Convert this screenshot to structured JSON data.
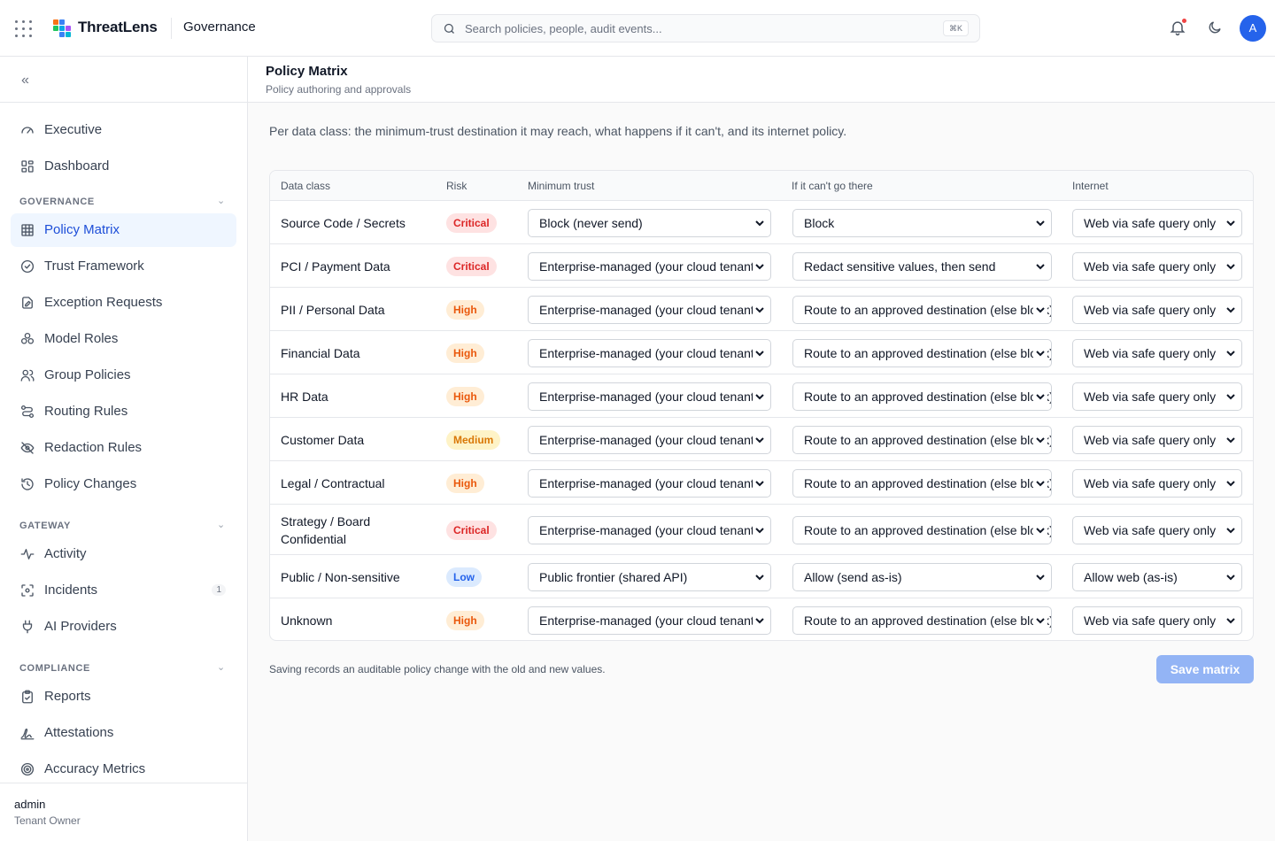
{
  "app": {
    "brand": "ThreatLens",
    "section": "Governance"
  },
  "search": {
    "placeholder": "Search policies, people, audit events...",
    "shortcut": "⌘K"
  },
  "avatar": {
    "initial": "A"
  },
  "sidebar": {
    "top_items": [
      {
        "label": "Executive",
        "icon": "gauge-icon"
      },
      {
        "label": "Dashboard",
        "icon": "dashboard-icon"
      }
    ],
    "groups": [
      {
        "title": "GOVERNANCE",
        "items": [
          {
            "label": "Policy Matrix",
            "icon": "grid-icon",
            "active": true
          },
          {
            "label": "Trust Framework",
            "icon": "shield-check-icon"
          },
          {
            "label": "Exception Requests",
            "icon": "file-edit-icon"
          },
          {
            "label": "Model Roles",
            "icon": "boxes-icon"
          },
          {
            "label": "Group Policies",
            "icon": "users-icon"
          },
          {
            "label": "Routing Rules",
            "icon": "route-icon"
          },
          {
            "label": "Redaction Rules",
            "icon": "eye-off-icon"
          },
          {
            "label": "Policy Changes",
            "icon": "history-icon"
          }
        ]
      },
      {
        "title": "GATEWAY",
        "items": [
          {
            "label": "Activity",
            "icon": "activity-icon"
          },
          {
            "label": "Incidents",
            "icon": "scan-icon",
            "count": "1"
          },
          {
            "label": "AI Providers",
            "icon": "plug-icon"
          }
        ]
      },
      {
        "title": "COMPLIANCE",
        "items": [
          {
            "label": "Reports",
            "icon": "clipboard-check-icon"
          },
          {
            "label": "Attestations",
            "icon": "signature-icon"
          },
          {
            "label": "Accuracy Metrics",
            "icon": "target-icon"
          }
        ]
      }
    ],
    "user": {
      "name": "admin",
      "role": "Tenant Owner"
    }
  },
  "page": {
    "title": "Policy Matrix",
    "subtitle": "Policy authoring and approvals"
  },
  "matrix": {
    "description": "Per data class: the minimum-trust destination it may reach, what happens if it can't, and its internet policy.",
    "columns": [
      "Data class",
      "Risk",
      "Minimum trust",
      "If it can't go there",
      "Internet"
    ],
    "rows": [
      {
        "data_class": "Source Code / Secrets",
        "risk": "Critical",
        "min_trust": "Block (never send)",
        "fallback": "Block",
        "internet": "Web via safe query only"
      },
      {
        "data_class": "PCI / Payment Data",
        "risk": "Critical",
        "min_trust": "Enterprise-managed (your cloud tenant)",
        "fallback": "Redact sensitive values, then send",
        "internet": "Web via safe query only"
      },
      {
        "data_class": "PII / Personal Data",
        "risk": "High",
        "min_trust": "Enterprise-managed (your cloud tenant)",
        "fallback": "Route to an approved destination (else block)",
        "internet": "Web via safe query only"
      },
      {
        "data_class": "Financial Data",
        "risk": "High",
        "min_trust": "Enterprise-managed (your cloud tenant)",
        "fallback": "Route to an approved destination (else block)",
        "internet": "Web via safe query only"
      },
      {
        "data_class": "HR Data",
        "risk": "High",
        "min_trust": "Enterprise-managed (your cloud tenant)",
        "fallback": "Route to an approved destination (else block)",
        "internet": "Web via safe query only"
      },
      {
        "data_class": "Customer Data",
        "risk": "Medium",
        "min_trust": "Enterprise-managed (your cloud tenant)",
        "fallback": "Route to an approved destination (else block)",
        "internet": "Web via safe query only"
      },
      {
        "data_class": "Legal / Contractual",
        "risk": "High",
        "min_trust": "Enterprise-managed (your cloud tenant)",
        "fallback": "Route to an approved destination (else block)",
        "internet": "Web via safe query only"
      },
      {
        "data_class": "Strategy / Board Confidential",
        "risk": "Critical",
        "min_trust": "Enterprise-managed (your cloud tenant)",
        "fallback": "Route to an approved destination (else block)",
        "internet": "Web via safe query only"
      },
      {
        "data_class": "Public / Non-sensitive",
        "risk": "Low",
        "min_trust": "Public frontier (shared API)",
        "fallback": "Allow (send as-is)",
        "internet": "Allow web (as-is)"
      },
      {
        "data_class": "Unknown",
        "risk": "High",
        "min_trust": "Enterprise-managed (your cloud tenant)",
        "fallback": "Route to an approved destination (else block)",
        "internet": "Web via safe query only"
      }
    ],
    "risk_colors": {
      "Critical": {
        "bg": "#fee2e2",
        "fg": "#dc2626"
      },
      "High": {
        "bg": "#ffedd5",
        "fg": "#ea580c"
      },
      "Medium": {
        "bg": "#fef3c7",
        "fg": "#d97706"
      },
      "Low": {
        "bg": "#dbeafe",
        "fg": "#2563eb"
      }
    }
  },
  "footer": {
    "note": "Saving records an auditable policy change with the old and new values.",
    "save_label": "Save matrix"
  }
}
